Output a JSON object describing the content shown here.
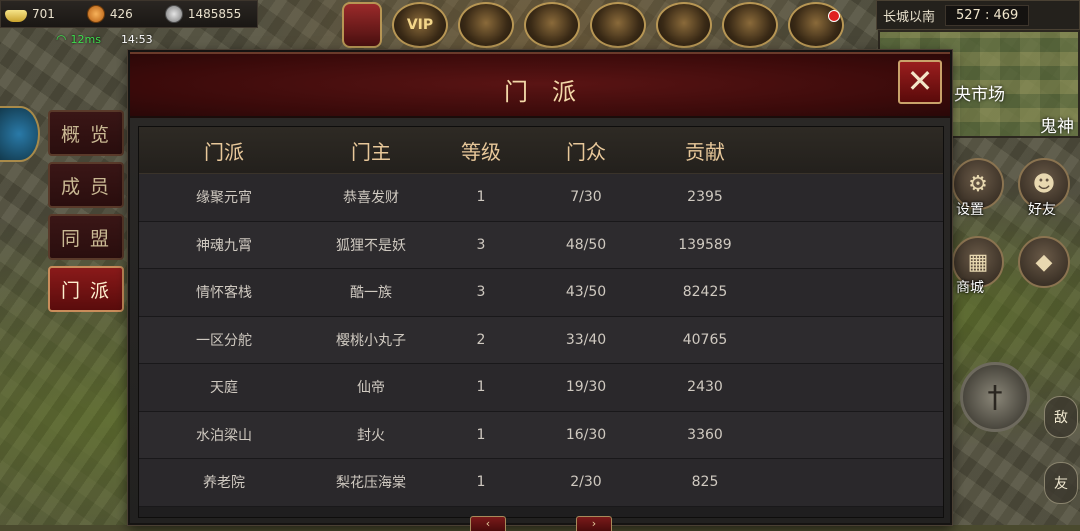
{
  "currency": {
    "ingot": "701",
    "gold": "426",
    "silver": "1485855"
  },
  "status": {
    "ping": "12ms",
    "time": "14:53"
  },
  "top_icons": [
    {
      "name": "banner-icon",
      "label": ""
    },
    {
      "name": "vip-icon",
      "label": "VIP"
    },
    {
      "name": "card-a-icon",
      "label": ""
    },
    {
      "name": "card-b-icon",
      "label": ""
    },
    {
      "name": "treasure-icon",
      "label": ""
    },
    {
      "name": "medal-icon",
      "label": ""
    },
    {
      "name": "gold-pile-icon",
      "label": ""
    },
    {
      "name": "chest-icon",
      "label": ""
    }
  ],
  "minimap": {
    "location": "长城以南",
    "coords": "527 : 469",
    "label_market": "央市场",
    "label_ghost": "鬼神"
  },
  "right_buttons": {
    "settings": "设置",
    "friends": "好友",
    "shop": "商城",
    "enemy": "敌",
    "friend_small": "友"
  },
  "side_tabs": [
    {
      "label": "概览",
      "active": false
    },
    {
      "label": "成员",
      "active": false
    },
    {
      "label": "同盟",
      "active": false
    },
    {
      "label": "门派",
      "active": true
    }
  ],
  "panel": {
    "title": "门派",
    "close": "✕",
    "columns": [
      "门派",
      "门主",
      "等级",
      "门众",
      "贡献"
    ],
    "rows": [
      [
        "缘聚元宵",
        "恭喜发财",
        "1",
        "7/30",
        "2395"
      ],
      [
        "神魂九霄",
        "狐狸不是妖",
        "3",
        "48/50",
        "139589"
      ],
      [
        "情怀客栈",
        "酷一族",
        "3",
        "43/50",
        "82425"
      ],
      [
        "一区分舵",
        "樱桃小丸子",
        "2",
        "33/40",
        "40765"
      ],
      [
        "天庭",
        "仙帝",
        "1",
        "19/30",
        "2430"
      ],
      [
        "水泊梁山",
        "封火",
        "1",
        "16/30",
        "3360"
      ],
      [
        "养老院",
        "梨花压海棠",
        "1",
        "2/30",
        "825"
      ]
    ],
    "prev": "‹",
    "next": "›"
  },
  "colors": {
    "accent_red": "#8a1a1a",
    "gold_text": "#e8c89a",
    "ping_green": "#3ddc4c"
  }
}
